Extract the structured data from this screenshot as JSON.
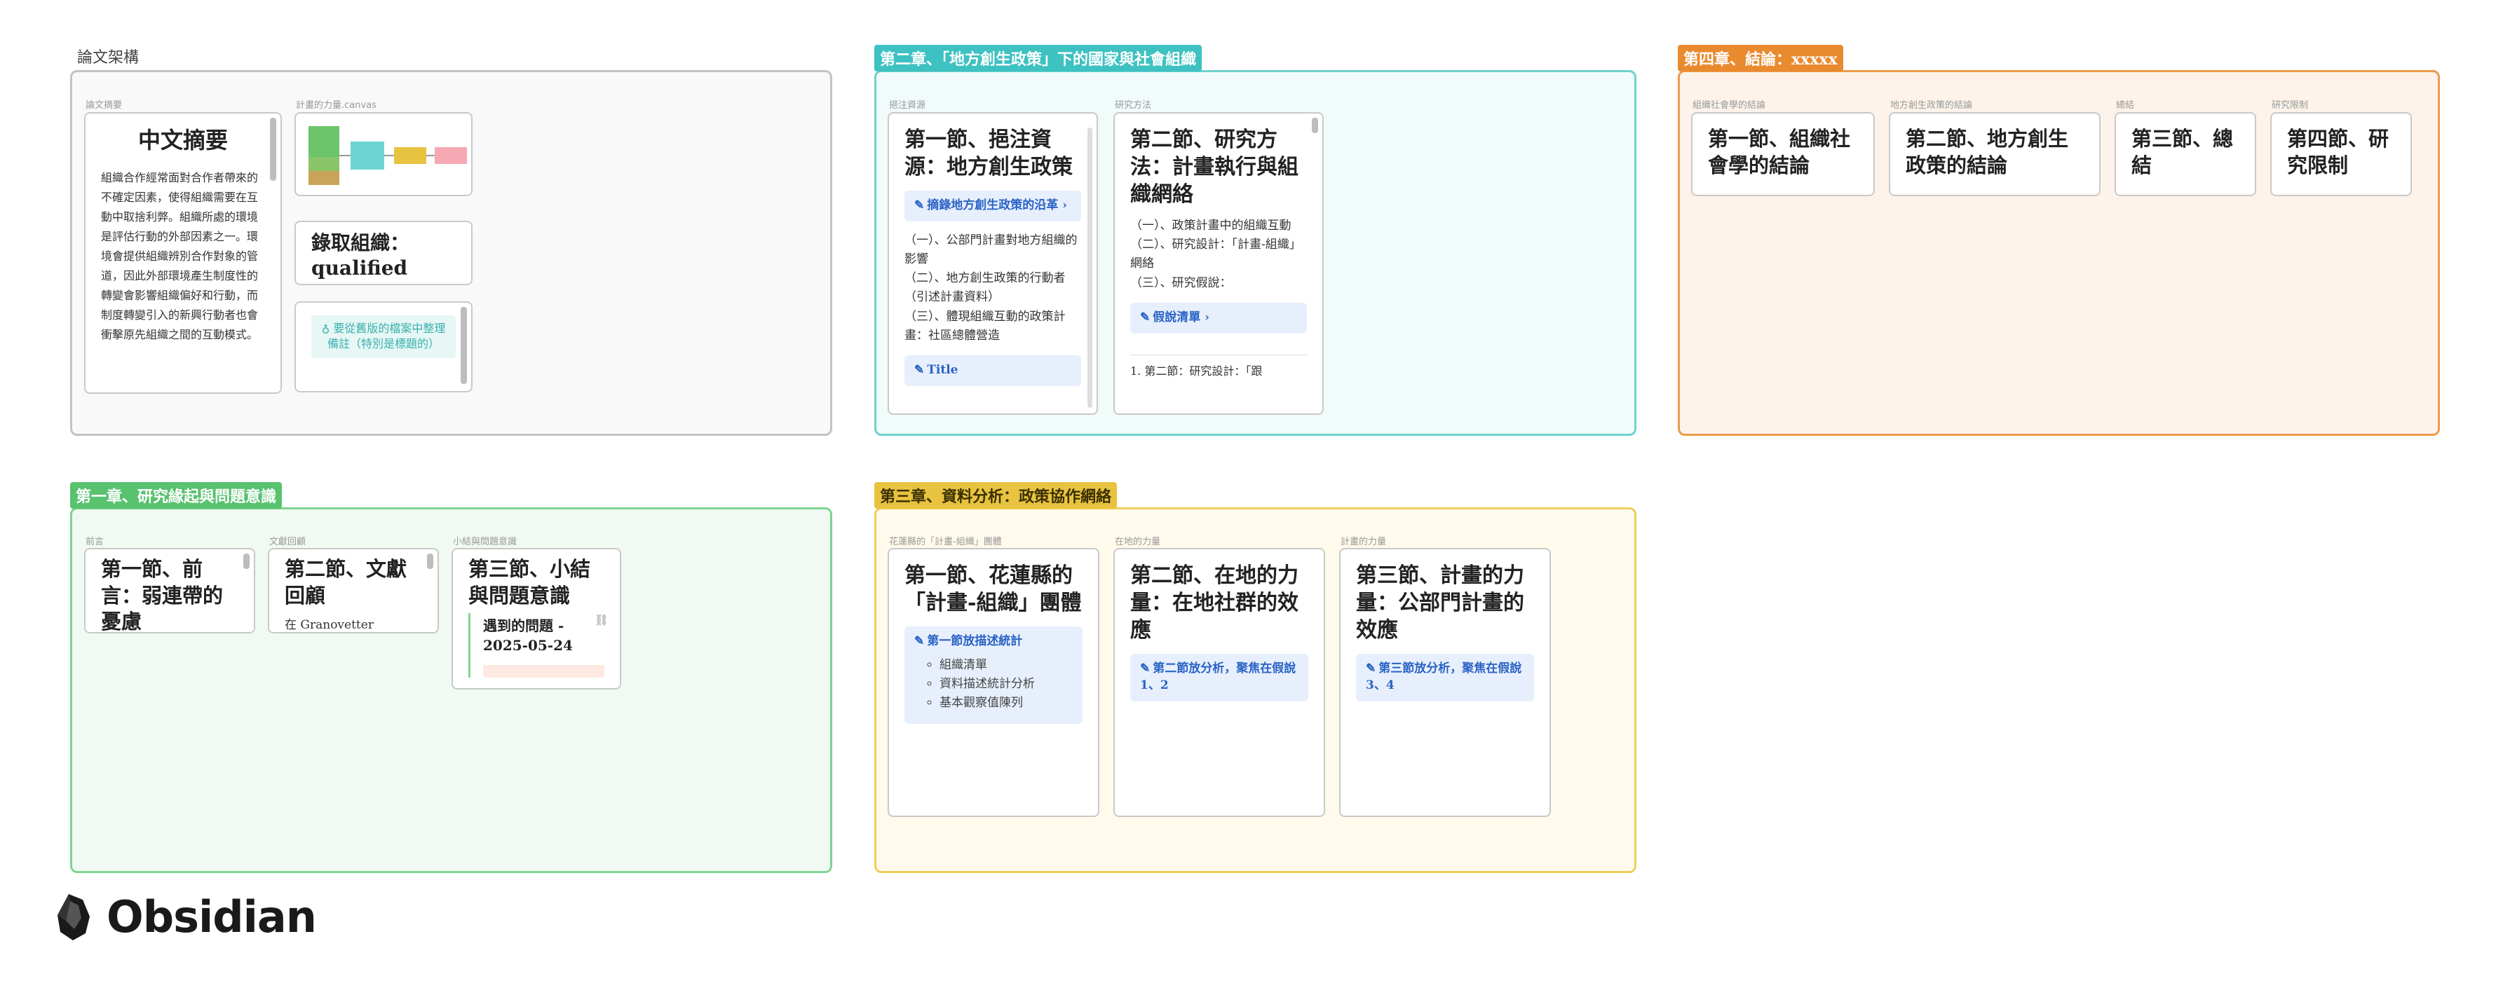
{
  "colors": {
    "gray": "#b8b8b8",
    "teal": "#3ec1c1",
    "orange": "#e98a2f",
    "green": "#58c26f",
    "yellow": "#e8c340",
    "callout_blue": "#2a63c6"
  },
  "groups": {
    "thesis": {
      "label": "論文架構"
    },
    "ch2": {
      "label": "第二章、「地方創生政策」下的國家與社會組織"
    },
    "ch4": {
      "label": "第四章、結論：xxxxx"
    },
    "ch1": {
      "label": "第一章、研究緣起與問題意識"
    },
    "ch3": {
      "label": "第三章、資料分析：政策協作網絡"
    }
  },
  "thesis": {
    "abstract": {
      "caption": "論文摘要",
      "title": "中文摘要",
      "body": "組織合作經常面對合作者帶來的不確定因素，使得組織需要在互動中取捨利弊。組織所處的環境是評估行動的外部因素之一。環境會提供組織辨別合作對象的管道，因此外部環境產生制度性的轉變會影響組織偏好和行動，而制度轉變引入的新興行動者也會衝擊原先組織之間的互動模式。"
    },
    "canvas": {
      "caption": "計畫的力量.canvas"
    },
    "qualified": {
      "title": "錄取組織：qualified"
    },
    "note": {
      "text": "要從舊版的檔案中整理備註（特別是標題的）"
    }
  },
  "ch2": {
    "resources": {
      "caption": "挹注資源",
      "title": "第一節、挹注資源：地方創生政策",
      "callout": "摘錄地方創生政策的沿革",
      "lines": [
        "（一）、公部門計畫對地方組織的影響",
        "（二）、地方創生政策的行動者（引述計畫資料）",
        "（三）、體現組織互動的政策計畫：社區總體營造"
      ],
      "callout2": "Title"
    },
    "method": {
      "caption": "研究方法",
      "title": "第二節、研究方法：計畫執行與組織網絡",
      "lines": [
        "（一）、政策計畫中的組織互動",
        "（二）、研究設計：「計畫-組織」網絡",
        "（三）、研究假說："
      ],
      "callout": "假說清單",
      "footnote": "1. 第二節：研究設計：「跟"
    }
  },
  "ch4": {
    "s1": {
      "caption": "組織社會學的結論",
      "title": "第一節、組織社會學的結論"
    },
    "s2": {
      "caption": "地方創生政策的結論",
      "title": "第二節、地方創生政策的結論"
    },
    "s3": {
      "caption": "總結",
      "title": "第三節、總結"
    },
    "s4": {
      "caption": "研究限制",
      "title": "第四節、研究限制"
    }
  },
  "ch1": {
    "s1": {
      "caption": "前言",
      "title": "第一節、前言：弱連帶的憂慮"
    },
    "s2": {
      "caption": "文獻回顧",
      "title": "第二節、文獻回顧",
      "text": "在 Granovetter"
    },
    "s3": {
      "caption": "小結與問題意識",
      "title": "第三節、小結與問題意識",
      "embed_title": "遇到的問題 - 2025-05-24"
    }
  },
  "ch3": {
    "s1": {
      "caption": "花蓮縣的「計畫-組織」團體",
      "title": "第一節、花蓮縣的「計畫-組織」團體",
      "callout": "第一節放描述統計",
      "items": [
        "組織清單",
        "資料描述統計分析",
        "基本觀察值陳列"
      ]
    },
    "s2": {
      "caption": "在地的力量",
      "title": "第二節、在地的力量：在地社群的效應",
      "callout": "第二節放分析，聚焦在假說1、2"
    },
    "s3": {
      "caption": "計畫的力量",
      "title": "第三節、計畫的力量：公部門計畫的效應",
      "callout": "第三節放分析，聚焦在假說3、4"
    }
  },
  "brand": {
    "name": "Obsidian",
    "logo_icon": "obsidian-gem-icon"
  }
}
